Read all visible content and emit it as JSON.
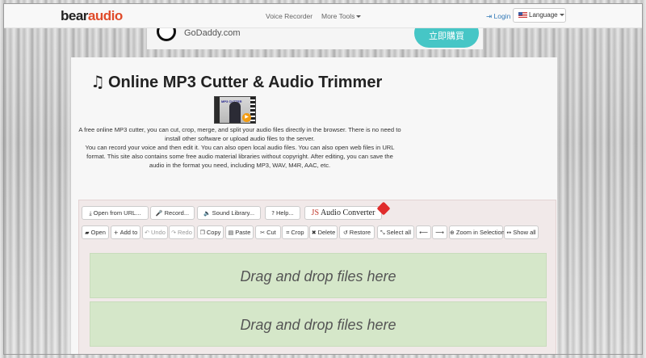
{
  "navbar": {
    "logo_part1": "bear",
    "logo_part2": "audio",
    "links": [
      "Voice Recorder",
      "More Tools"
    ],
    "login": "Login",
    "language": "Language"
  },
  "ad": {
    "brand": "GoDaddy.com",
    "cta": "立即購買"
  },
  "main": {
    "title": "Online MP3 Cutter & Audio Trimmer",
    "description": [
      "A free online MP3 cutter, you can cut, crop, merge, and split your audio files directly in the browser. There is no need to install other software or upload audio files to the server.",
      "You can record your voice and then edit it. You can also open local audio files. You can also open web files in URL format. This site also contains some free audio material libraries without copyright. After editing, you can save the audio in the format you need, including MP3, WAV, M4R, AAC, etc."
    ],
    "thumb_text": "MP3 CUTTER"
  },
  "toolbar1": {
    "open_url": "Open from URL...",
    "record": "Record...",
    "sound_library": "Sound Library...",
    "help": "Help...",
    "converter_js": "JS",
    "converter_rest": "Audio Converter"
  },
  "toolbar2": {
    "open": "Open",
    "add_to": "Add to",
    "undo": "Undo",
    "redo": "Redo",
    "copy": "Copy",
    "paste": "Paste",
    "cut": "Cut",
    "crop": "Crop",
    "delete": "Delete",
    "restore": "Restore",
    "select_all": "Select all",
    "zoom_selection": "Zoom in Selection",
    "show_all": "Show all"
  },
  "dropzones": [
    "Drag and drop files here",
    "Drag and drop files here"
  ],
  "colors": {
    "accent": "#e04b2a",
    "link": "#337ab7",
    "dropzone": "#d5e7c9"
  }
}
